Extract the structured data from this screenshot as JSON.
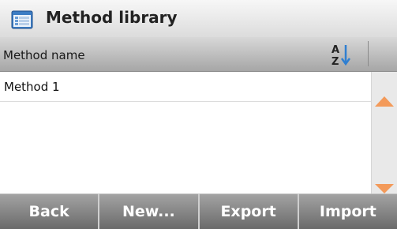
{
  "window": {
    "title": "Method library",
    "icon": "window-list-icon"
  },
  "table": {
    "column_header": "Method name",
    "sort_icon": "sort-a-z-icon",
    "sort_glyph_top": "A",
    "sort_glyph_bottom": "Z",
    "rows": [
      "Method 1"
    ]
  },
  "scroll": {
    "up_icon": "scroll-up-icon",
    "down_icon": "scroll-down-icon",
    "arrow_color": "#f39a5a"
  },
  "footer": {
    "buttons": [
      "Back",
      "New...",
      "Export",
      "Import"
    ]
  }
}
